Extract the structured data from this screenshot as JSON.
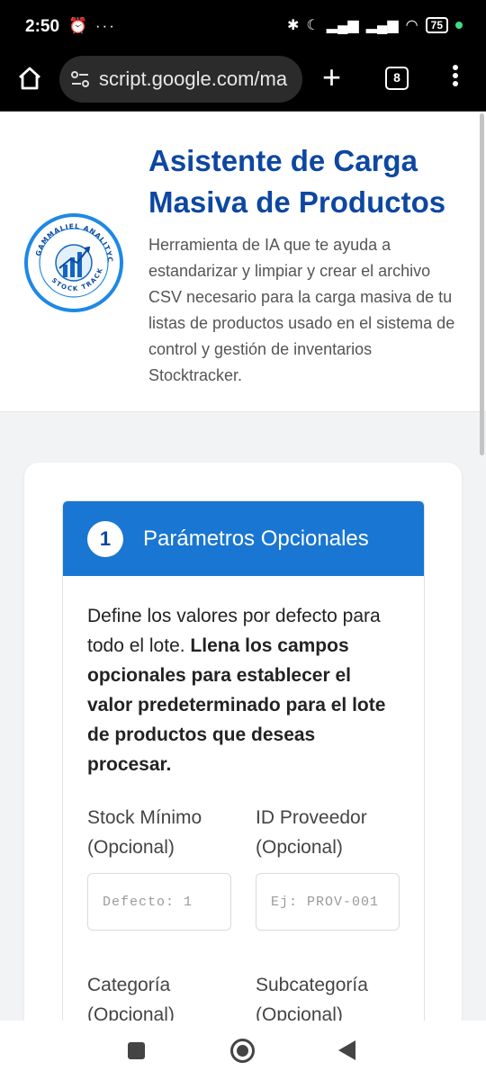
{
  "status_bar": {
    "time": "2:50",
    "left_icons": "⏰ ···",
    "battery": "75",
    "icons": [
      "alarm-icon",
      "bluetooth-icon",
      "moon-icon",
      "signal-icon",
      "wifi-icon",
      "battery-icon"
    ]
  },
  "browser": {
    "url": "script.google.com/ma",
    "tab_count": "8"
  },
  "header": {
    "title_line1": "Asistente de Carga",
    "title_line2": "Masiva de Productos",
    "description": "Herramienta de IA que te ayuda a estandarizar y limpiar y crear el archivo CSV necesario para la carga masiva de tu listas de productos usado en el sistema de control y gestión de inventarios Stocktracker.",
    "logo_top_text": "GAMMALIEL ANALITYCS",
    "logo_bottom_text": "STOCK TRACKER"
  },
  "section": {
    "step_number": "1",
    "title": "Parámetros Opcionales",
    "intro_plain": "Define los valores por defecto para todo el lote. ",
    "intro_bold": "Llena los campos opcionales para establecer el valor predeterminado para el lote de productos que deseas procesar.",
    "fields": [
      {
        "label": "Stock Mínimo (Opcional)",
        "placeholder": "Defecto: 1"
      },
      {
        "label": "ID Proveedor (Opcional)",
        "placeholder": "Ej: PROV-001"
      },
      {
        "label": "Categoría (Opcional)"
      },
      {
        "label": "Subcategoría (Opcional)"
      }
    ]
  },
  "colors": {
    "title": "#0d47a1",
    "section_header": "#1976d2",
    "logo_ring": "#1e88e5"
  }
}
